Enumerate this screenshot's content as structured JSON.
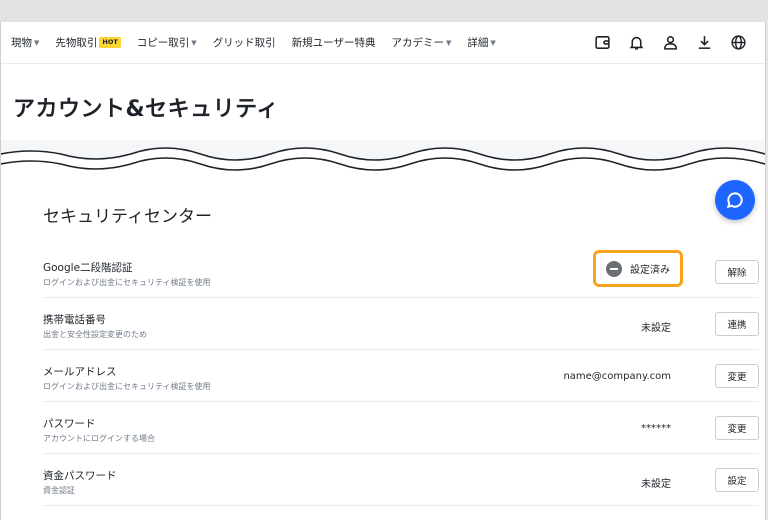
{
  "nav": {
    "items": [
      {
        "label": "現物",
        "caret": true
      },
      {
        "label": "先物取引",
        "badge": "HOT",
        "caret": false
      },
      {
        "label": "コピー取引",
        "caret": true
      },
      {
        "label": "グリッド取引",
        "caret": false
      },
      {
        "label": "新規ユーザー特典",
        "caret": false
      },
      {
        "label": "アカデミー",
        "caret": true
      },
      {
        "label": "詳細",
        "caret": true
      }
    ],
    "icons": [
      "wallet-icon",
      "bell-icon",
      "user-icon",
      "download-icon",
      "globe-icon"
    ]
  },
  "page": {
    "title": "アカウント&セキュリティ"
  },
  "security": {
    "section_title": "セキュリティセンター",
    "rows": [
      {
        "title": "Google二段階認証",
        "desc": "ログインおよび出金にセキュリティ検証を使用",
        "status": "設定済み",
        "button": "解除",
        "highlighted": true
      },
      {
        "title": "携帯電話番号",
        "desc": "出金と安全性設定変更のため",
        "status": "未設定",
        "button": "連携"
      },
      {
        "title": "メールアドレス",
        "desc": "ログインおよび出金にセキュリティ検証を使用",
        "status": "name@company.com",
        "button": "変更"
      },
      {
        "title": "パスワード",
        "desc": "アカウントにログインする場合",
        "status": "******",
        "button": "変更"
      },
      {
        "title": "資金パスワード",
        "desc": "資金認証",
        "status": "未設定",
        "button": "設定"
      }
    ]
  },
  "colors": {
    "highlight": "#f7a21b",
    "chat_bubble": "#1e64ff",
    "hot_badge": "#fcd535"
  }
}
